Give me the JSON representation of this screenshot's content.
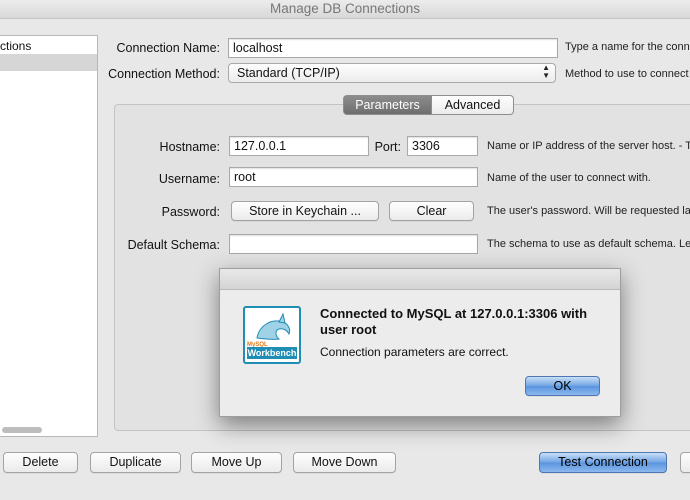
{
  "window": {
    "title": "Manage DB Connections"
  },
  "connections": {
    "header": "ctions"
  },
  "form": {
    "connection_name": {
      "label": "Connection Name:",
      "value": "localhost",
      "help": "Type a name for the conn"
    },
    "connection_method": {
      "label": "Connection Method:",
      "value": "Standard (TCP/IP)",
      "help": "Method to use to connect to"
    }
  },
  "tabs": {
    "active": "Parameters",
    "inactive": "Advanced"
  },
  "params": {
    "hostname": {
      "label": "Hostname:",
      "value": "127.0.0.1",
      "help": "Name or IP address of the server host. - TCP"
    },
    "port": {
      "label": "Port:",
      "value": "3306"
    },
    "username": {
      "label": "Username:",
      "value": "root",
      "help": "Name of the user to connect with."
    },
    "password": {
      "label": "Password:",
      "store_button": "Store in Keychain ...",
      "clear_button": "Clear",
      "help": "The user's password. Will be requested later"
    },
    "default_schema": {
      "label": "Default Schema:",
      "value": "",
      "help": "The schema to use as default schema. Leave"
    }
  },
  "dialog": {
    "heading": "Connected to MySQL at 127.0.0.1:3306 with user root",
    "message": "Connection parameters are correct.",
    "ok_button": "OK",
    "icon": {
      "name": "mysql-workbench-icon",
      "text_top": "MySQL",
      "text_main": "Workbench"
    }
  },
  "bottom_buttons": {
    "delete": "Delete",
    "duplicate": "Duplicate",
    "move_up": "Move Up",
    "move_down": "Move Down",
    "test_connection": "Test Connection"
  },
  "colors": {
    "accent_blue": "#5b94de",
    "icon_teal": "#1f8db4"
  }
}
